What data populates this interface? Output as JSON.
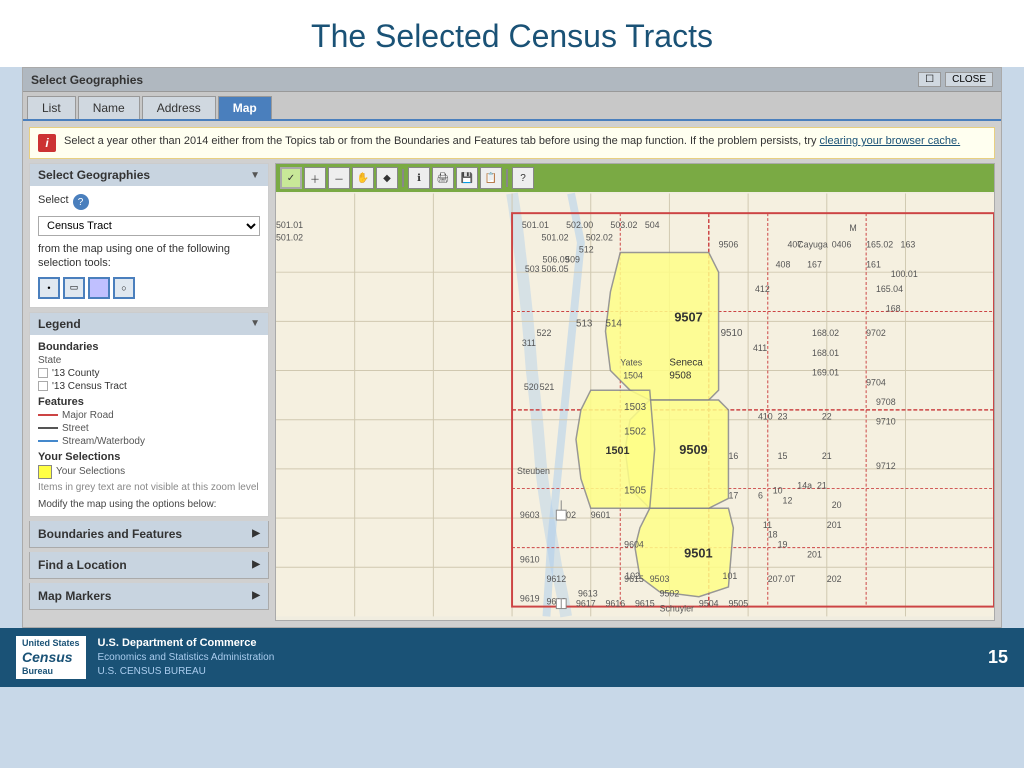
{
  "header": {
    "title": "The Selected Census Tracts"
  },
  "window": {
    "title": "Select Geographies",
    "close_label": "CLOSE",
    "tabs": [
      {
        "label": "List",
        "active": false
      },
      {
        "label": "Name",
        "active": false
      },
      {
        "label": "Address",
        "active": false
      },
      {
        "label": "Map",
        "active": true
      }
    ]
  },
  "info_bar": {
    "icon": "i",
    "text": "Select a year other than 2014 either from the Topics tab or from the Boundaries and Features tab before using the map function. If the problem persists, try ",
    "link_text": "clearing your browser cache.",
    "link_href": "#"
  },
  "select_geo": {
    "section_title": "Select Geographies",
    "select_label": "Select",
    "dropdown_value": "Census Tract",
    "from_map_text": "from the map using one of the following selection tools:"
  },
  "legend": {
    "section_title": "Legend",
    "boundaries_title": "Boundaries",
    "state_label": "State",
    "county_label": "'13 County",
    "census_tract_label": "'13 Census Tract",
    "features_title": "Features",
    "major_road_label": "Major Road",
    "street_label": "Street",
    "stream_label": "Stream/Waterbody",
    "your_selections_title": "Your Selections",
    "your_selections_label": "Your Selections",
    "grey_text_note": "Items in grey text are not visible at this zoom level",
    "modify_text": "Modify the map using the options below:"
  },
  "collapsible_sections": [
    {
      "label": "Boundaries and Features",
      "arrow": "▶"
    },
    {
      "label": "Find a Location",
      "arrow": "▶"
    },
    {
      "label": "Map Markers",
      "arrow": "▶"
    }
  ],
  "map_toolbar": {
    "tools": [
      "✓",
      "＋",
      "－",
      "✋",
      "♦",
      "ℹ",
      "🖨",
      "💾",
      "📋",
      "?"
    ]
  },
  "footer": {
    "logo_line1": "United States",
    "logo_line2": "Census",
    "logo_line3": "Bureau",
    "dept_line1": "U.S. Department of Commerce",
    "dept_line2": "Economics and Statistics Administration",
    "dept_line3": "U.S. CENSUS BUREAU",
    "page_number": "15"
  }
}
